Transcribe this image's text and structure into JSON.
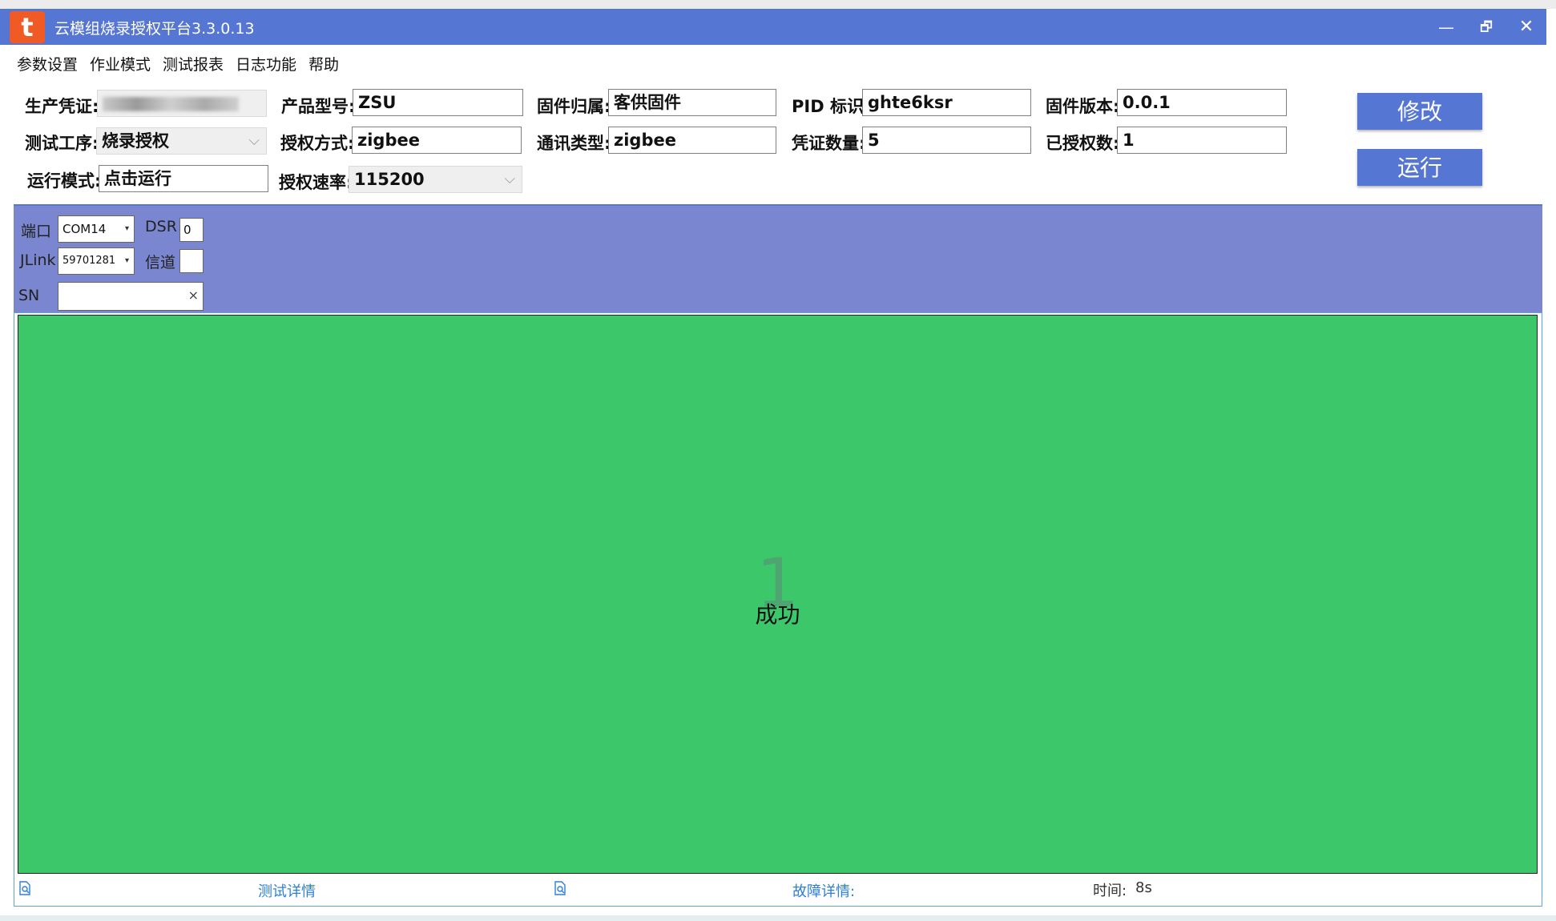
{
  "window": {
    "logo_letter": "t",
    "title": "云模组烧录授权平台3.3.0.13",
    "minimize_glyph": "—",
    "maximize_glyph": "🗗",
    "close_glyph": "✕"
  },
  "menu": [
    "参数设置",
    "作业模式",
    "测试报表",
    "日志功能",
    "帮助"
  ],
  "form": {
    "production_credential": {
      "label": "生产凭证:",
      "value": ""
    },
    "product_model": {
      "label": "产品型号:",
      "value": "ZSU"
    },
    "firmware_owner": {
      "label": "固件归属:",
      "value": "客供固件"
    },
    "pid": {
      "label": "PID 标识:",
      "value": "ghte6ksr"
    },
    "firmware_version": {
      "label": "固件版本:",
      "value": "0.0.1"
    },
    "test_process": {
      "label": "测试工序:",
      "value": "烧录授权"
    },
    "auth_method": {
      "label": "授权方式:",
      "value": "zigbee"
    },
    "comm_type": {
      "label": "通讯类型:",
      "value": "zigbee"
    },
    "credential_count": {
      "label": "凭证数量:",
      "value": "5"
    },
    "authorized_count": {
      "label": "已授权数:",
      "value": "1"
    },
    "run_mode": {
      "label": "运行模式:",
      "value": "点击运行"
    },
    "auth_rate": {
      "label": "授权速率:",
      "value": "115200"
    }
  },
  "buttons": {
    "modify": "修改",
    "run": "运行"
  },
  "config": {
    "port_label": "端口",
    "port_value": "COM14",
    "dsr_label": "DSR",
    "dsr_value": "0",
    "jlink_label": "JLink",
    "jlink_value": "59701281",
    "channel_label": "信道",
    "channel_value": "",
    "sn_label": "SN",
    "sn_value": "",
    "sn_clear": "×",
    "dropdown_glyph": "▾"
  },
  "result": {
    "count": "1",
    "status": "成功",
    "color": "#3cc76b"
  },
  "statusbar": {
    "test_details": "测试详情",
    "fault_details": "故障详情:",
    "time_label": "时间:",
    "time_value": "8s"
  },
  "colors": {
    "accent": "#5576d2",
    "config_panel": "#7a86cf",
    "success": "#3cc76b",
    "link": "#2e7fd6"
  }
}
